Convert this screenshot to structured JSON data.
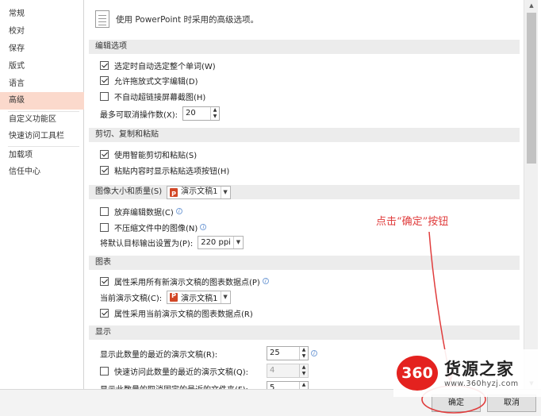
{
  "sidebar": {
    "items": [
      {
        "label": "常规"
      },
      {
        "label": "校对"
      },
      {
        "label": "保存"
      },
      {
        "label": "版式"
      },
      {
        "label": "语言"
      },
      {
        "label": "高级"
      },
      {
        "label": "自定义功能区"
      },
      {
        "label": "快速访问工具栏"
      },
      {
        "label": "加载项"
      },
      {
        "label": "信任中心"
      }
    ],
    "active": "高级"
  },
  "header": {
    "text": "使用 PowerPoint 时采用的高级选项。",
    "icon": "document-options-icon"
  },
  "sections": {
    "editing": {
      "title": "编辑选项",
      "opt_select_whole_word": {
        "label": "选定时自动选定整个单词(W)",
        "checked": true
      },
      "opt_drag_drop": {
        "label": "允许拖放式文字编辑(D)",
        "checked": true
      },
      "opt_no_hyperlink_screenshot": {
        "label": "不自动超链接屏幕截图(H)",
        "checked": false
      },
      "undo_label": "最多可取消操作数(X):",
      "undo_value": "20"
    },
    "clipboard": {
      "title": "剪切、复制和粘贴",
      "opt_smart_cut": {
        "label": "使用智能剪切和粘贴(S)",
        "checked": true
      },
      "opt_paste_options": {
        "label": "粘贴内容时显示粘贴选项按钮(H)",
        "checked": true
      }
    },
    "image": {
      "title": "图像大小和质量(S)",
      "doc": "演示文稿1",
      "opt_discard_edit": {
        "label": "放弃编辑数据(C)",
        "checked": false
      },
      "opt_no_compress": {
        "label": "不压缩文件中的图像(N)",
        "checked": false
      },
      "resolution_label": "将默认目标输出设置为(P):",
      "resolution_value": "220 ppi"
    },
    "chart": {
      "title": "图表",
      "opt_all_new": {
        "label": "属性采用所有新演示文稿的图表数据点(P)",
        "checked": true
      },
      "current_label": "当前演示文稿(C):",
      "current_value": "演示文稿1",
      "opt_current": {
        "label": "属性采用当前演示文稿的图表数据点(R)",
        "checked": true
      }
    },
    "display": {
      "title": "显示",
      "recent_label": "显示此数量的最近的演示文稿(R):",
      "recent_value": "25",
      "opt_quick_access": {
        "label": "快速访问此数量的最近的演示文稿(Q):",
        "checked": false
      },
      "quick_value": "4",
      "cut_label": "显示此数量的取消固定的最近的文件夹(F):",
      "cut_value": "5"
    }
  },
  "buttons": {
    "ok": "确定",
    "cancel": "取消"
  },
  "annotation": {
    "text": "点击“确定”按钮",
    "color": "#e03c3c"
  },
  "watermark": {
    "badge": "360",
    "title": "货源之家",
    "url": "www.360hyzj.com"
  }
}
